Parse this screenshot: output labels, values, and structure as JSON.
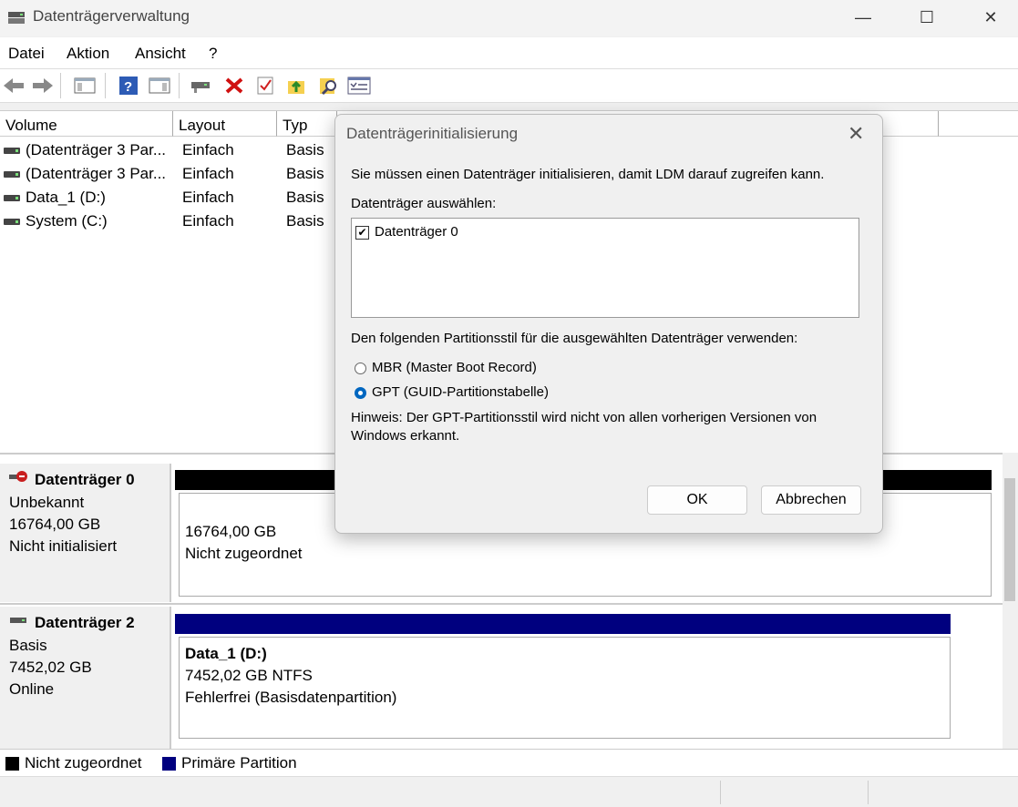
{
  "window": {
    "title": "Datenträgerverwaltung",
    "minimize": "—",
    "maximize": "☐",
    "close": "✕"
  },
  "menu": [
    "Datei",
    "Aktion",
    "Ansicht",
    "?"
  ],
  "columns": [
    "Volume",
    "Layout",
    "Typ"
  ],
  "volumes": [
    {
      "name": "(Datenträger 3 Par...",
      "layout": "Einfach",
      "type": "Basis"
    },
    {
      "name": "(Datenträger 3 Par...",
      "layout": "Einfach",
      "type": "Basis"
    },
    {
      "name": "Data_1 (D:)",
      "layout": "Einfach",
      "type": "Basis"
    },
    {
      "name": "System (C:)",
      "layout": "Einfach",
      "type": "Basis"
    }
  ],
  "disks": [
    {
      "name": "Datenträger 0",
      "kind": "Unbekannt",
      "size": "16764,00 GB",
      "status": "Nicht initialisiert",
      "partition": {
        "line1": "16764,00 GB",
        "line2": "Nicht zugeordnet"
      },
      "bar_color": "#000000"
    },
    {
      "name": "Datenträger 2",
      "kind": "Basis",
      "size": "7452,02 GB",
      "status": "Online",
      "partition": {
        "title": "Data_1  (D:)",
        "line1": "7452,02 GB NTFS",
        "line2": "Fehlerfrei (Basisdatenpartition)"
      },
      "bar_color": "#00007f"
    }
  ],
  "legend": [
    {
      "label": "Nicht zugeordnet",
      "color": "#000000"
    },
    {
      "label": "Primäre Partition",
      "color": "#00007f"
    }
  ],
  "dialog": {
    "title": "Datenträgerinitialisierung",
    "intro": "Sie müssen einen Datenträger initialisieren, damit LDM darauf zugreifen kann.",
    "select_label": "Datenträger auswählen:",
    "disk_item": "Datenträger 0",
    "disk_checked": true,
    "style_label": "Den folgenden Partitionsstil für die ausgewählten Datenträger verwenden:",
    "mbr": "MBR (Master Boot Record)",
    "gpt": "GPT (GUID-Partitionstabelle)",
    "selected_style": "GPT",
    "note": "Hinweis: Der GPT-Partitionsstil wird nicht von allen vorherigen Versionen von Windows erkannt.",
    "ok": "OK",
    "cancel": "Abbrechen"
  },
  "icons": [
    "back-arrow-icon",
    "forward-arrow-icon",
    "console-tree-icon",
    "help-icon",
    "action-pane-icon",
    "connect-drive-icon",
    "delete-icon",
    "properties-check-icon",
    "folder-up-icon",
    "search-icon",
    "list-view-icon"
  ]
}
